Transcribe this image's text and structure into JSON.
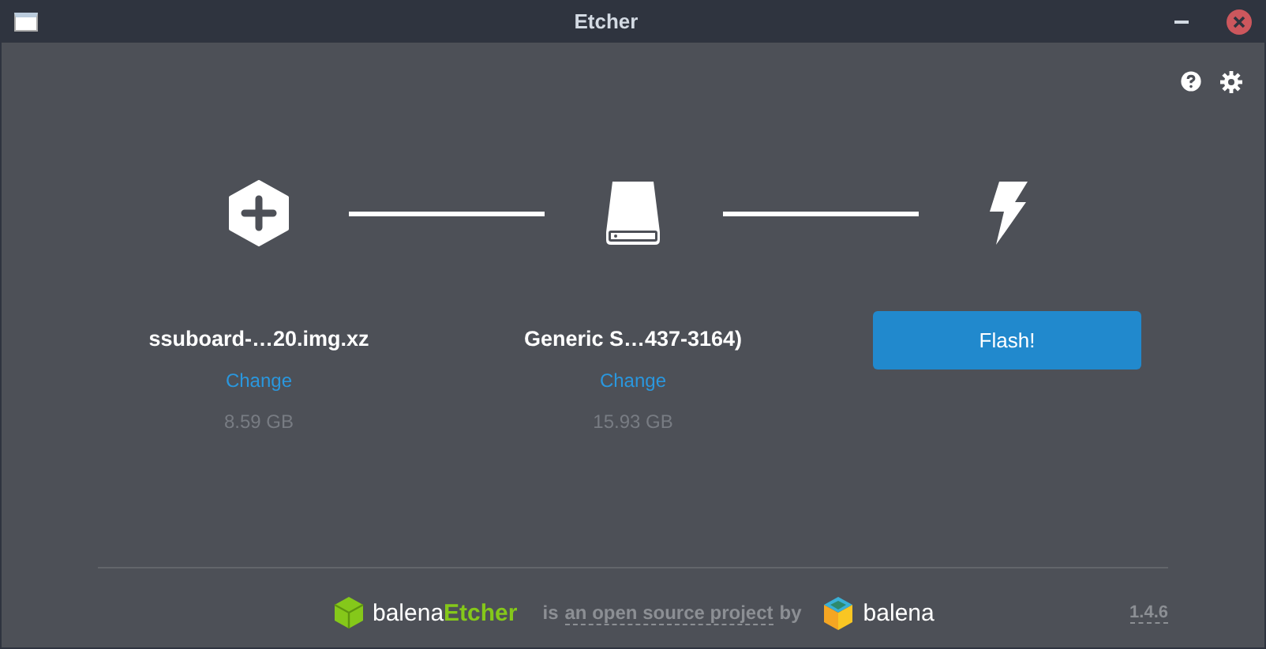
{
  "window": {
    "title": "Etcher"
  },
  "steps": [
    {
      "kind": "image",
      "name": "ssuboard-…20.img.xz",
      "action": "Change",
      "size": "8.59 GB"
    },
    {
      "kind": "drive",
      "name": "Generic S…437-3164)",
      "action": "Change",
      "size": "15.93 GB"
    },
    {
      "kind": "flash",
      "button": "Flash!"
    }
  ],
  "footer": {
    "logo_prefix": "balena",
    "logo_suffix": "Etcher",
    "credit_prefix": "is",
    "credit_link": "an open source project",
    "credit_suffix": "by",
    "company": "balena",
    "version": "1.4.6"
  }
}
